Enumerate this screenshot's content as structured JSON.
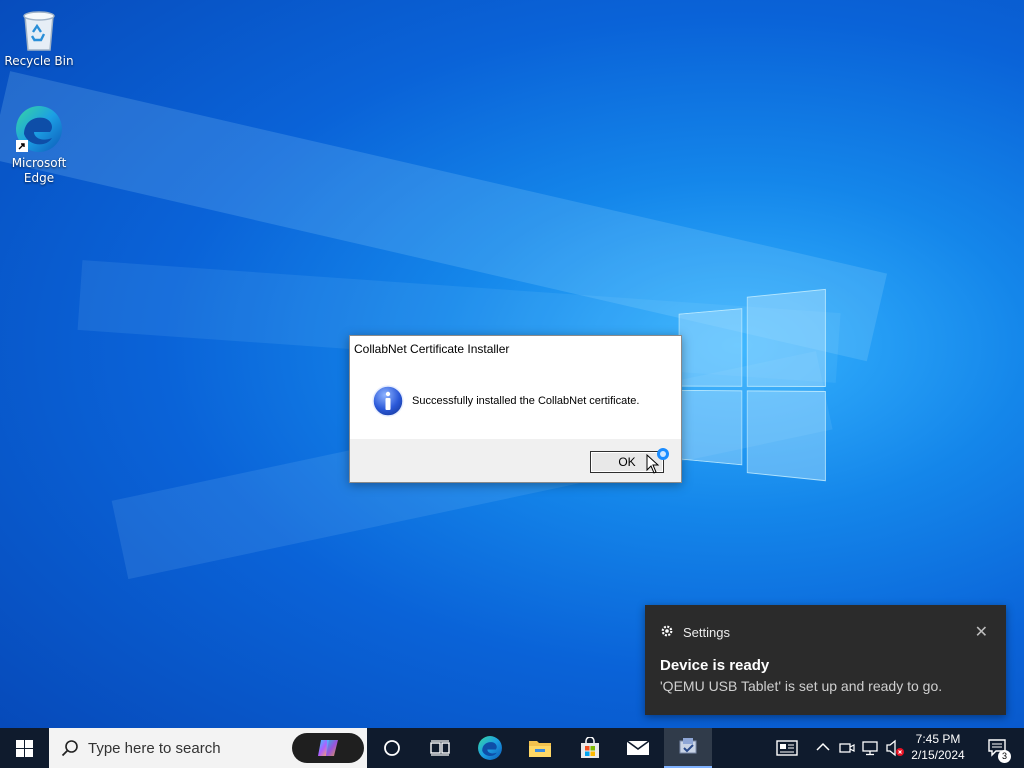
{
  "desktop": {
    "icons": [
      {
        "label": "Recycle Bin"
      },
      {
        "label": "Microsoft Edge"
      }
    ]
  },
  "dialog": {
    "title": "CollabNet Certificate Installer",
    "message": "Successfully installed the CollabNet certificate.",
    "ok_label": "OK",
    "icon": "info-icon"
  },
  "toast": {
    "app": "Settings",
    "title": "Device is ready",
    "body": "'QEMU USB Tablet' is set up and ready to go.",
    "close_glyph": "✕"
  },
  "taskbar": {
    "search_placeholder": "Type here to search",
    "pinned": [
      "task-view",
      "edge",
      "file-explorer",
      "microsoft-store",
      "mail",
      "certificate-installer"
    ],
    "clock_time": "7:45 PM",
    "clock_date": "2/15/2024",
    "notification_count": "3"
  }
}
